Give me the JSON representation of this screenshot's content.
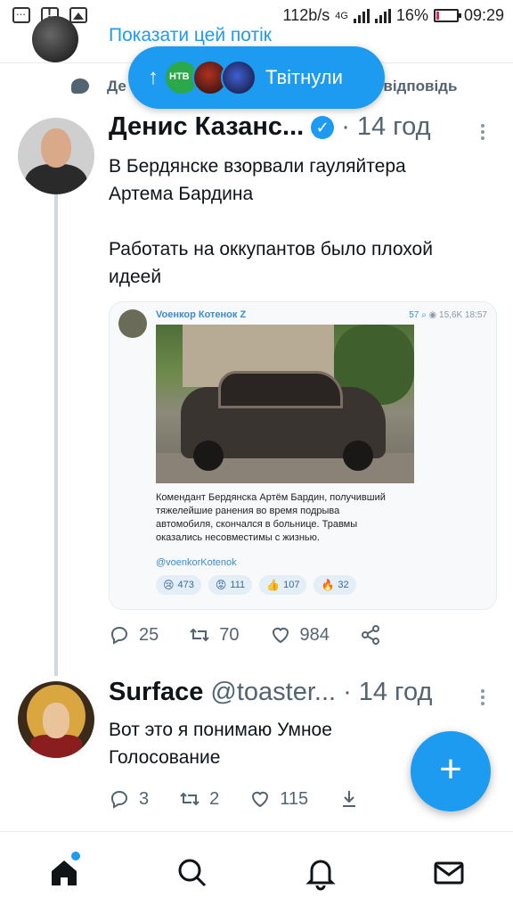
{
  "status_bar": {
    "speed": "112b/s",
    "network": "4G",
    "battery": "16%",
    "time": "09:29"
  },
  "prev_thread": {
    "link": "Показати цей потік"
  },
  "notification": {
    "left": "Де",
    "right": ") відповідь"
  },
  "new_tweets_pill": {
    "arrow": "↑",
    "label": "Твітнули"
  },
  "tweets": [
    {
      "name": "Денис Казанс...",
      "handle": "",
      "time": "14 год",
      "verified": true,
      "text": "В Бердянске взорвали гауляйтера\nАртема Бардина\n\nРаботать на оккупантов было плохой\nидеей",
      "embed": {
        "channel": "Voенкор Котенок Z",
        "comments": "57",
        "views": "15,6K",
        "time": "18:57",
        "text": "Комендант Бердянска Артём Бардин, получивший\nтяжелейшие ранения во время подрыва\nавтомобиля, скончался в больнице. Травмы\nоказались несовместимы с жизнью.",
        "link": "@voenkorKotenok",
        "reactions": [
          {
            "emoji": "😢",
            "count": "473"
          },
          {
            "emoji": "😡",
            "count": "111"
          },
          {
            "emoji": "👍",
            "count": "107"
          },
          {
            "emoji": "🔥",
            "count": "32"
          }
        ]
      },
      "replies": "25",
      "retweets": "70",
      "likes": "984"
    },
    {
      "name": "Surface",
      "handle": "@toaster...",
      "time": "14 год",
      "verified": false,
      "text": "Вот это я понимаю Умное\nГолосование",
      "replies": "3",
      "retweets": "2",
      "likes": "115"
    }
  ],
  "fab": {
    "label": "+"
  },
  "colors": {
    "accent": "#1d9bf0",
    "muted": "#536471"
  }
}
